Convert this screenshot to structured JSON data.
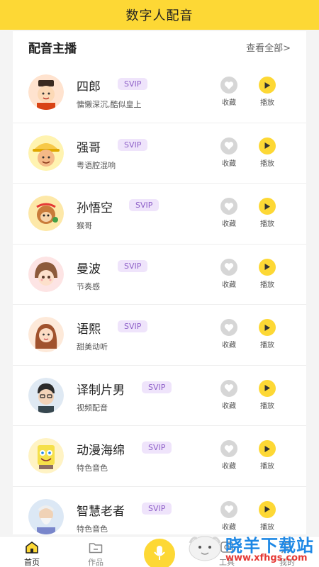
{
  "header": {
    "title": "数字人配音"
  },
  "section": {
    "title": "配音主播",
    "see_all": "查看全部>"
  },
  "actions": {
    "fav_label": "收藏",
    "play_label": "播放"
  },
  "anchors": [
    {
      "name": "四郎",
      "badge": "SVIP",
      "desc": "慵懒深沉,酷似皇上"
    },
    {
      "name": "强哥",
      "badge": "SVIP",
      "desc": "粤语腔混响"
    },
    {
      "name": "孙悟空",
      "badge": "SVIP",
      "desc": "猴哥"
    },
    {
      "name": "曼波",
      "badge": "SVIP",
      "desc": "节奏感"
    },
    {
      "name": "语熙",
      "badge": "SVIP",
      "desc": "甜美动听"
    },
    {
      "name": "译制片男",
      "badge": "SVIP",
      "desc": "视频配音"
    },
    {
      "name": "动漫海绵",
      "badge": "SVIP",
      "desc": "特色音色"
    },
    {
      "name": "智慧老者",
      "badge": "SVIP",
      "desc": "特色音色"
    }
  ],
  "tabs": {
    "home": "首页",
    "works": "作品",
    "tools": "工具",
    "mine": "我的"
  },
  "watermark": {
    "text": "晓羊下载站",
    "url": "www.xfhgs.com"
  },
  "colors": {
    "brand_yellow": "#fdd835",
    "svip_bg": "#efe4fb",
    "svip_text": "#8e60c8",
    "watermark_blue": "#1e88e5",
    "watermark_red": "#e53935"
  }
}
